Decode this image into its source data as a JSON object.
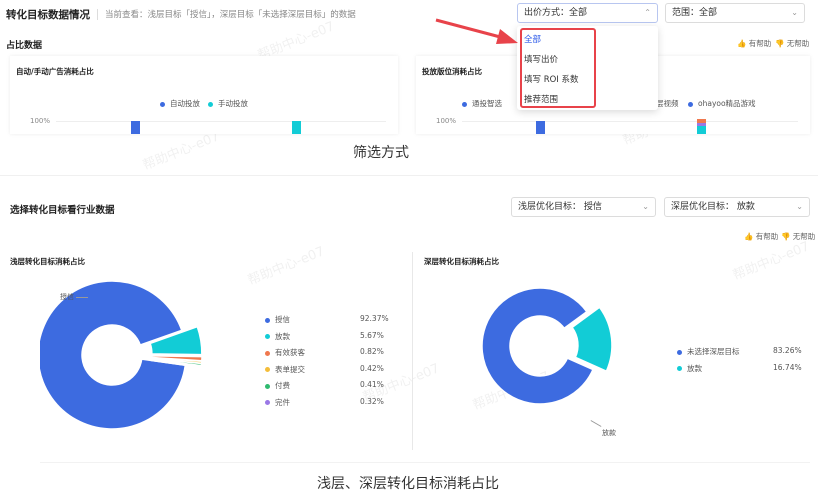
{
  "header": {
    "title": "转化目标数据情况",
    "subtitle": "当前查看：浅层目标「授信」，深层目标「未选择深层目标」的数据",
    "bid_select": "出价方式：全部",
    "range_select": "范围：全部"
  },
  "dropdown": {
    "items": [
      "全部",
      "填写出价",
      "填写 ROI 系数",
      "推荐范围"
    ]
  },
  "share": {
    "title": "占比数据",
    "helpful": "有帮助",
    "unhelpful": "无帮助",
    "left_panel": {
      "title": "自动/手动广告消耗占比",
      "legend": [
        "自动投放",
        "手动投放"
      ],
      "tick": "100%"
    },
    "right_panel": {
      "title": "投放版位消耗占比",
      "legend": [
        "通投智选",
        "...精品游戏",
        "ohayoo精品游戏"
      ],
      "legend_visible_partial": "层视频",
      "tick": "100%"
    },
    "caption": "筛选方式"
  },
  "industry": {
    "title": "选择转化目标看行业数据",
    "shallow_select": "浅层优化目标：  授信",
    "deep_select": "深层优化目标：  放款",
    "helpful": "有帮助",
    "unhelpful": "无帮助",
    "shallow_panel": {
      "title": "浅层转化目标消耗占比",
      "callout": "授信",
      "legend": [
        {
          "name": "授信",
          "value": "92.37%"
        },
        {
          "name": "放款",
          "value": "5.67%"
        },
        {
          "name": "有效获客",
          "value": "0.82%"
        },
        {
          "name": "表单提交",
          "value": "0.42%"
        },
        {
          "name": "付费",
          "value": "0.41%"
        },
        {
          "name": "完件",
          "value": "0.32%"
        }
      ]
    },
    "deep_panel": {
      "title": "深层转化目标消耗占比",
      "callout": "放款",
      "legend": [
        {
          "name": "未选择深层目标",
          "value": "83.26%"
        },
        {
          "name": "放款",
          "value": "16.74%"
        }
      ]
    },
    "caption": "浅层、深层转化目标消耗占比"
  },
  "watermark": "帮助中心-e07",
  "chart_data": [
    {
      "type": "pie",
      "title": "浅层转化目标消耗占比",
      "categories": [
        "授信",
        "放款",
        "有效获客",
        "表单提交",
        "付费",
        "完件"
      ],
      "values": [
        92.37,
        5.67,
        0.82,
        0.42,
        0.41,
        0.32
      ],
      "colors": [
        "#3d6be0",
        "#12ccd6",
        "#f0784e",
        "#f4bd3a",
        "#2fba6f",
        "#9a78e6"
      ]
    },
    {
      "type": "pie",
      "title": "深层转化目标消耗占比",
      "categories": [
        "未选择深层目标",
        "放款"
      ],
      "values": [
        83.26,
        16.74
      ],
      "colors": [
        "#3d6be0",
        "#12ccd6"
      ]
    }
  ],
  "colors": {
    "blue": "#3d6be0",
    "cyan": "#12ccd6",
    "accent_red": "#e8434a",
    "link_blue": "#2c5ae9"
  }
}
